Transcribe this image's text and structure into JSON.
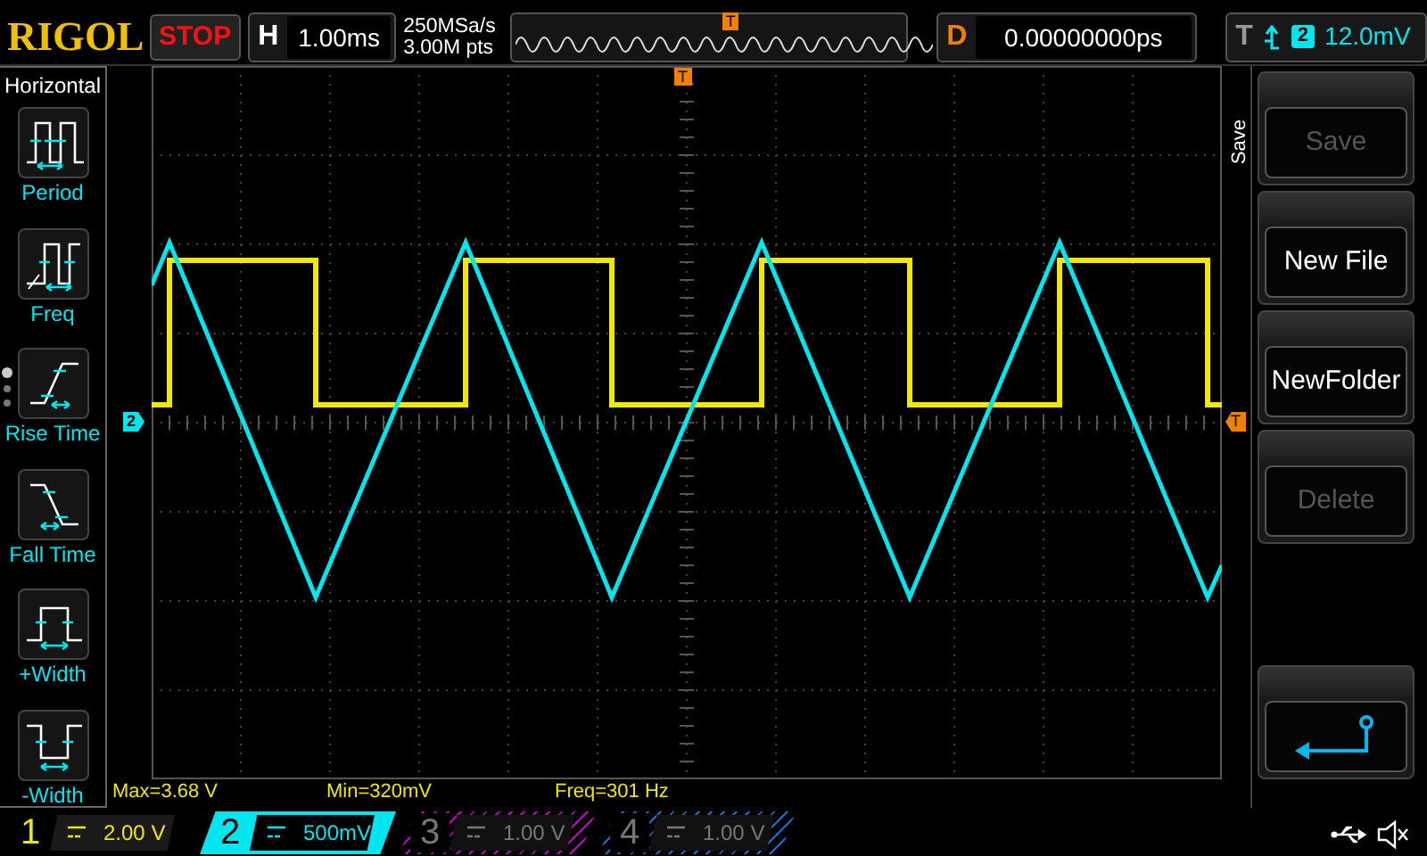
{
  "top_bar": {
    "logo": "RIGOL",
    "run_status": "STOP",
    "timebase": {
      "label": "H",
      "value": "1.00ms"
    },
    "sample_rate": "250MSa/s",
    "memory_depth": "3.00M pts",
    "overview_trigger_marker": "T",
    "delay": {
      "label": "D",
      "value": "0.00000000ps"
    },
    "trigger": {
      "label": "T",
      "source": "2",
      "level": "12.0mV"
    }
  },
  "left_menu": {
    "title": "Horizontal",
    "items": [
      {
        "kind": "period",
        "label": "Period"
      },
      {
        "kind": "freq",
        "label": "Freq"
      },
      {
        "kind": "rise",
        "label": "Rise Time"
      },
      {
        "kind": "fall",
        "label": "Fall Time"
      },
      {
        "kind": "pwidth",
        "label": "+Width"
      },
      {
        "kind": "nwidth",
        "label": "-Width"
      }
    ]
  },
  "screen": {
    "channel_marker": "2",
    "trigger_top_marker": "T",
    "trigger_level_marker": "T"
  },
  "measurements": [
    "Max=3.68 V",
    "Min=320mV",
    "Freq=301 Hz"
  ],
  "right_menu": {
    "title": "Save",
    "buttons": [
      {
        "kind": "text",
        "label": "Save",
        "disabled": true
      },
      {
        "kind": "text",
        "label": "New File",
        "disabled": false
      },
      {
        "kind": "text",
        "label": "NewFolder",
        "disabled": false
      },
      {
        "kind": "text",
        "label": "Delete",
        "disabled": true
      },
      {
        "kind": "back"
      }
    ]
  },
  "channels": [
    {
      "number": "1",
      "scale": "2.00 V",
      "on": true,
      "selected": false,
      "color": "#f0e800"
    },
    {
      "number": "2",
      "scale": "500mV",
      "on": true,
      "selected": true,
      "color": "#00e5ee"
    },
    {
      "number": "3",
      "scale": "1.00 V",
      "on": false,
      "selected": false,
      "color": "#c000c0"
    },
    {
      "number": "4",
      "scale": "1.00 V",
      "on": false,
      "selected": false,
      "color": "#1070d0"
    }
  ]
}
